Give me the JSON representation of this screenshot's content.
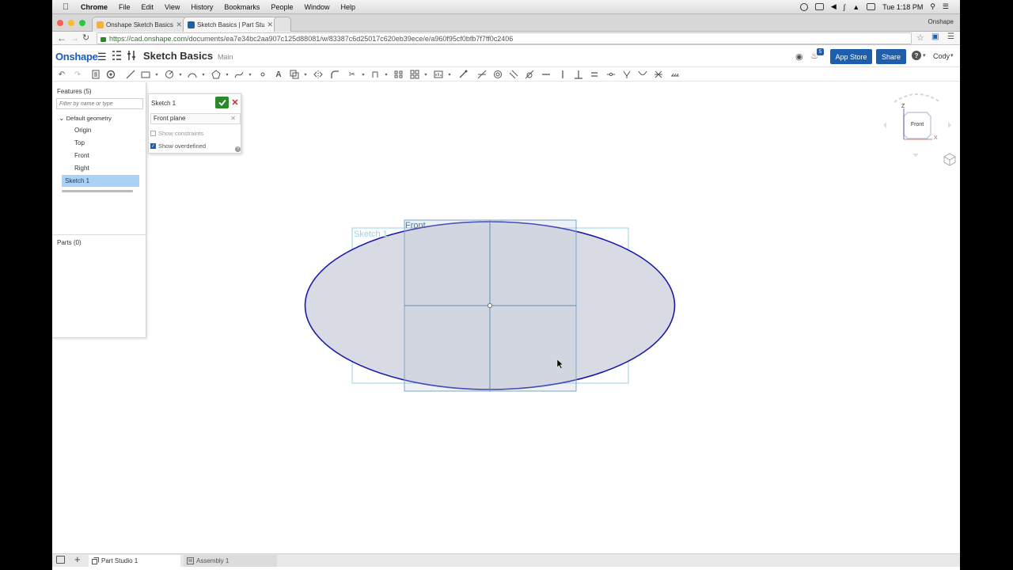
{
  "mac_menu": {
    "app": "Chrome",
    "items": [
      "File",
      "Edit",
      "View",
      "History",
      "Bookmarks",
      "People",
      "Window",
      "Help"
    ],
    "clock": "Tue 1:18 PM"
  },
  "browser": {
    "tabs": [
      {
        "title": "Onshape Sketch Basics - G"
      },
      {
        "title": "Sketch Basics | Part Studio"
      }
    ],
    "profile": "Onshape",
    "url_domain": "https://cad.onshape.com",
    "url_path": "/documents/ea7e34bc2aa907c125d88081/w/83387c6d25017c620eb39ece/e/a960f95cf0bfb7f7ff0c2406"
  },
  "header": {
    "logo": "Onshape",
    "doc_title": "Sketch Basics",
    "workspace": "Main",
    "notification_count": "5",
    "app_store_label": "App Store",
    "share_label": "Share",
    "user": "Cody"
  },
  "features_panel": {
    "title": "Features (5)",
    "filter_placeholder": "Filter by name or type",
    "group": "Default geometry",
    "items": [
      "Origin",
      "Top",
      "Front",
      "Right"
    ],
    "selected": "Sketch 1",
    "parts_title": "Parts (0)"
  },
  "sketch_dialog": {
    "title": "Sketch 1",
    "plane": "Front plane",
    "show_constraints": "Show constraints",
    "show_overdefined": "Show overdefined",
    "show_constraints_checked": false,
    "show_overdefined_checked": true
  },
  "canvas": {
    "sketch_label": "Sketch 1",
    "plane_label": "Front",
    "view_cube_face": "Front",
    "axis_z": "Z",
    "axis_x": "X"
  },
  "bottom_tabs": {
    "part_studio": "Part Studio 1",
    "assembly": "Assembly 1"
  },
  "colors": {
    "accent": "#1d5fad",
    "sketch_curve": "#1a1aa8",
    "selection": "#a9d2f5",
    "confirm": "#2a8a2a"
  }
}
